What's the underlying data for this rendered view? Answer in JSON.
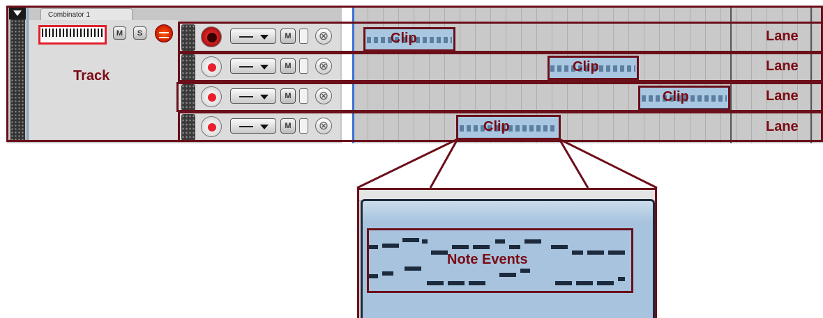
{
  "track": {
    "name": "Combinator 1",
    "label": "Track",
    "mute_label": "M",
    "solo_label": "S"
  },
  "lanes": [
    {
      "label": "Lane",
      "mute_label": "M",
      "recording": true,
      "clip_label": "Clip"
    },
    {
      "label": "Lane",
      "mute_label": "M",
      "recording": false,
      "clip_label": "Clip"
    },
    {
      "label": "Lane",
      "mute_label": "M",
      "recording": false,
      "clip_label": "Clip"
    },
    {
      "label": "Lane",
      "mute_label": "M",
      "recording": false,
      "clip_label": "Clip"
    }
  ],
  "zoom": {
    "label": "Note Events"
  },
  "colors": {
    "annotation": "#6b0f1a",
    "clip_fill": "#a9c7e1",
    "record_red": "#e8202e",
    "playhead": "#3c6fd4"
  },
  "icons": {
    "collapse": "triangle-down-icon",
    "keyboard": "keyboard-icon",
    "power": "power-icon",
    "record": "record-icon",
    "delete": "close-circle-icon"
  }
}
